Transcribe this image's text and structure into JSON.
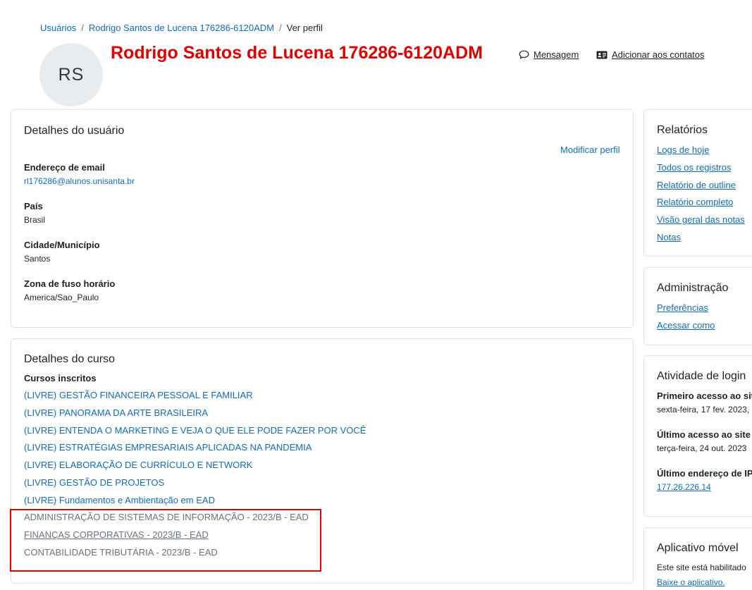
{
  "breadcrumb": {
    "items": [
      "Usuários",
      "Rodrigo Santos de Lucena 176286-6120ADM",
      "Ver perfil"
    ],
    "separator": "/"
  },
  "profile": {
    "initials": "RS",
    "name": "Rodrigo Santos de Lucena 176286-6120ADM",
    "message_label": "Mensagem",
    "add_contact_label": "Adicionar aos contatos"
  },
  "user_details": {
    "title": "Detalhes do usuário",
    "edit_link": "Modificar perfil",
    "fields": [
      {
        "label": "Endereço de email",
        "value": "rl176286@alunos.unisanta.br"
      },
      {
        "label": "País",
        "value": "Brasil"
      },
      {
        "label": "Cidade/Município",
        "value": "Santos"
      },
      {
        "label": "Zona de fuso horário",
        "value": "America/Sao_Paulo"
      }
    ]
  },
  "course_details": {
    "title": "Detalhes do curso",
    "subtitle": "Cursos inscritos",
    "courses": [
      "(LIVRE) GESTÃO FINANCEIRA PESSOAL E FAMILIAR",
      "(LIVRE) PANORAMA DA ARTE BRASILEIRA",
      "(LIVRE) ENTENDA O MARKETING E VEJA O QUE ELE PODE FAZER POR VOCÊ",
      "(LIVRE) ESTRATÉGIAS EMPRESARIAIS APLICADAS NA PANDEMIA",
      "(LIVRE) ELABORAÇÃO DE CURRÍCULO E NETWORK",
      "(LIVRE) GESTÃO DE PROJETOS",
      "(LIVRE) Fundamentos e Ambientação em EAD",
      "ADMINISTRAÇÃO DE SISTEMAS DE INFORMAÇÃO - 2023/B - EAD",
      "FINANÇAS CORPORATIVAS - 2023/B - EAD",
      "CONTABILIDADE TRIBUTÁRIA - 2023/B - EAD"
    ]
  },
  "reports": {
    "title": "Relatórios",
    "links": [
      "Logs de hoje",
      "Todos os registros",
      "Relatório de outline",
      "Relatório completo",
      "Visão geral das notas",
      "Notas"
    ]
  },
  "administration": {
    "title": "Administração",
    "links": [
      "Preferências",
      "Acessar como"
    ]
  },
  "login_activity": {
    "title": "Atividade de login",
    "first_access_label": "Primeiro acesso ao site",
    "first_access_value": "sexta-feira, 17 fev. 2023,",
    "last_access_label": "Último acesso ao site",
    "last_access_value": "terça-feira, 24 out. 2023",
    "last_ip_label": "Último endereço de IP",
    "last_ip_value": "177.26.226.14"
  },
  "mobile_app": {
    "title": "Aplicativo móvel",
    "text": "Este site está habilitado",
    "link": "Baixe o aplicativo."
  },
  "colors": {
    "link": "#0f6cbf",
    "name_red": "#e00000",
    "border": "#dee2e6",
    "avatar_bg": "#e9ecef"
  }
}
